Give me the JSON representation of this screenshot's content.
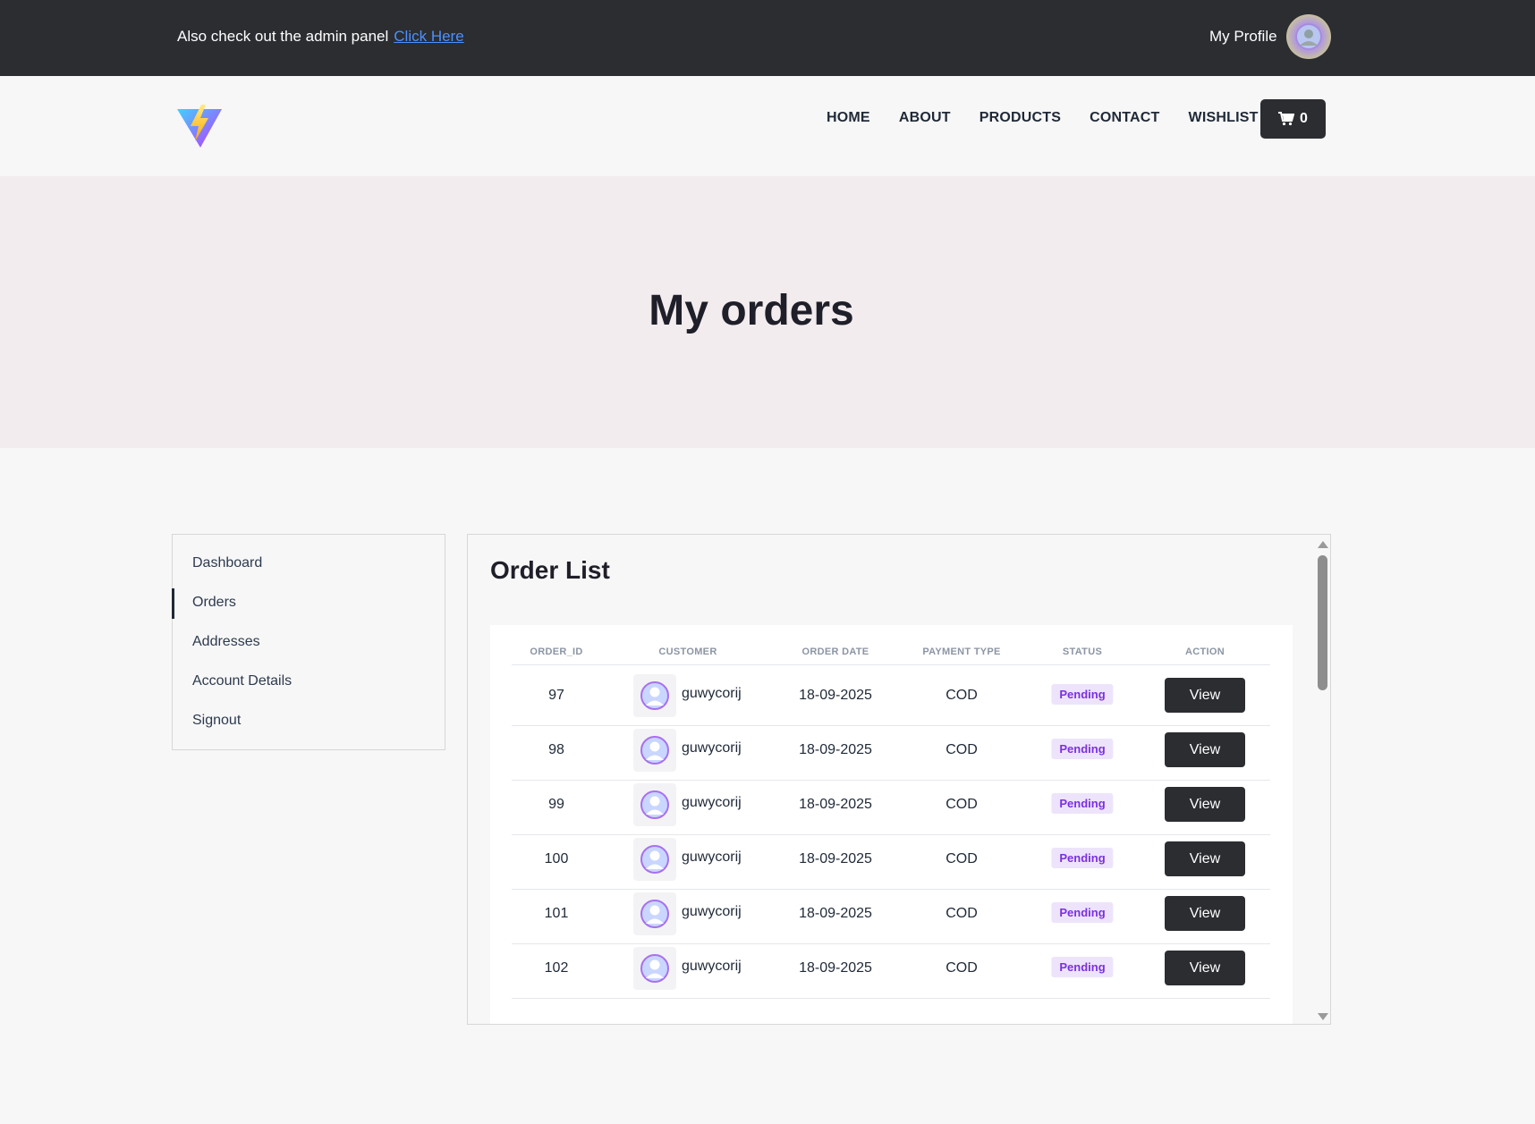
{
  "topbar": {
    "notice": "Also check out the admin panel",
    "link": "Click Here",
    "profile_label": "My Profile"
  },
  "nav": {
    "links": [
      "HOME",
      "ABOUT",
      "PRODUCTS",
      "CONTACT",
      "WISHLIST"
    ],
    "cart_count": "0"
  },
  "hero": {
    "title": "My orders"
  },
  "sidebar": {
    "items": [
      "Dashboard",
      "Orders",
      "Addresses",
      "Account Details",
      "Signout"
    ],
    "active": "Orders"
  },
  "orders": {
    "title": "Order List",
    "columns": [
      "ORDER_ID",
      "CUSTOMER",
      "ORDER DATE",
      "PAYMENT TYPE",
      "STATUS",
      "ACTION"
    ],
    "rows": [
      {
        "id": "97",
        "customer": "guwycorij",
        "date": "18-09-2025",
        "payment": "COD",
        "status": "Pending",
        "action": "View"
      },
      {
        "id": "98",
        "customer": "guwycorij",
        "date": "18-09-2025",
        "payment": "COD",
        "status": "Pending",
        "action": "View"
      },
      {
        "id": "99",
        "customer": "guwycorij",
        "date": "18-09-2025",
        "payment": "COD",
        "status": "Pending",
        "action": "View"
      },
      {
        "id": "100",
        "customer": "guwycorij",
        "date": "18-09-2025",
        "payment": "COD",
        "status": "Pending",
        "action": "View"
      },
      {
        "id": "101",
        "customer": "guwycorij",
        "date": "18-09-2025",
        "payment": "COD",
        "status": "Pending",
        "action": "View"
      },
      {
        "id": "102",
        "customer": "guwycorij",
        "date": "18-09-2025",
        "payment": "COD",
        "status": "Pending",
        "action": "View"
      }
    ]
  },
  "colors": {
    "dark": "#2b2d31",
    "link": "#4d90ff",
    "hero_bg": "#f3ecee",
    "badge_bg": "#ede4fb",
    "badge_text": "#7c2fe0"
  },
  "icons": {
    "logo": "vite-logo-icon",
    "cart": "cart-icon",
    "avatar": "user-avatar-icon"
  }
}
